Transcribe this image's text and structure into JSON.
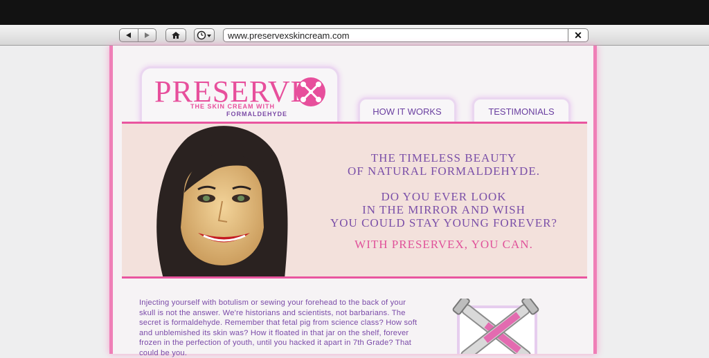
{
  "browser": {
    "url": "www.preservexskincream.com",
    "back_icon": "triangle-left",
    "forward_icon": "triangle-right",
    "home_icon": "house",
    "history_icon": "clock"
  },
  "logo": {
    "word": "PRESERVE",
    "tagline_1": "THE SKIN CREAM WITH",
    "tagline_2": "FORMALDEHYDE",
    "brand_color": "#e74f9c",
    "accent_color": "#7b4aa6"
  },
  "nav": {
    "how_it_works": "HOW IT WORKS",
    "testimonials": "TESTIMONIALS"
  },
  "hero": {
    "line1": "THE TIMELESS BEAUTY",
    "line2": "OF NATURAL FORMALDEHYDE.",
    "line3": "DO YOU EVER LOOK",
    "line4": "IN THE MIRROR AND WISH",
    "line5": "YOU COULD STAY YOUNG FOREVER?",
    "line6": "WITH PRESERVEX, YOU CAN."
  },
  "body": {
    "paragraph": "Injecting yourself with botulism or sewing your forehead to the back of your skull is not the answer. We're historians and scientists, not barbarians. The secret is formaldehyde. Remember that fetal pig from science class? How soft and unblemished its skin was? How it floated in that jar on the shelf, forever frozen in the perfection of youth, until you hacked it apart in 7th Grade? That could be you."
  }
}
